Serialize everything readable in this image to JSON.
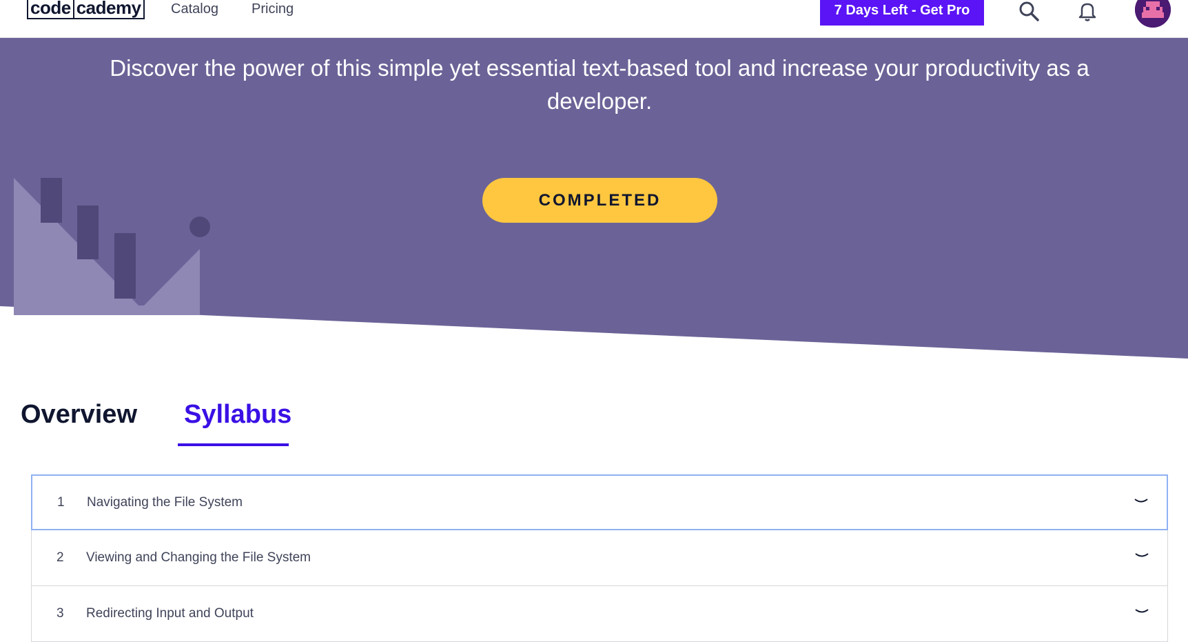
{
  "header": {
    "logo_left": "code",
    "logo_right": "cademy",
    "nav": [
      "Catalog",
      "Pricing"
    ],
    "pro_button": "7 Days Left - Get Pro",
    "icons": [
      "search-icon",
      "bell-icon",
      "avatar"
    ]
  },
  "hero": {
    "description": "Discover the power of this simple yet essential text-based tool and increase your productivity as a developer.",
    "status_button": "COMPLETED",
    "colors": {
      "background": "#6b6397",
      "button": "#ffc740"
    }
  },
  "tabs": [
    {
      "label": "Overview",
      "active": false
    },
    {
      "label": "Syllabus",
      "active": true
    }
  ],
  "syllabus": [
    {
      "number": "1",
      "title": "Navigating the File System"
    },
    {
      "number": "2",
      "title": "Viewing and Changing the File System"
    },
    {
      "number": "3",
      "title": "Redirecting Input and Output"
    }
  ],
  "colors": {
    "accent": "#3a10e5",
    "pro": "#5a14f5",
    "text": "#10162f"
  }
}
